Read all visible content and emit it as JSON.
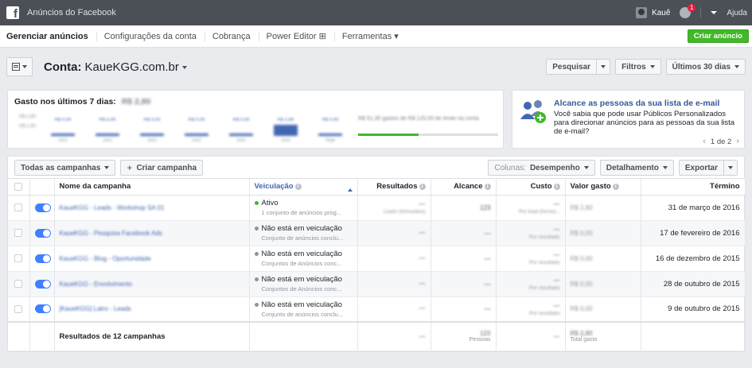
{
  "topbar": {
    "logo_glyph": "f",
    "app_title": "Anúncios do Facebook",
    "user_name": "Kauê",
    "notification_count": "1",
    "help_label": "Ajuda"
  },
  "nav": {
    "items": [
      {
        "label": "Gerenciar anúncios",
        "active": true
      },
      {
        "label": "Configurações da conta"
      },
      {
        "label": "Cobrança"
      },
      {
        "label": "Power Editor ⊞"
      },
      {
        "label": "Ferramentas ▾"
      }
    ],
    "create_ad_label": "Criar anúncio"
  },
  "account": {
    "label": "Conta:",
    "name": "KaueKGG.com.br",
    "search_label": "Pesquisar",
    "filters_label": "Filtros",
    "date_range_label": "Últimos 30 dias"
  },
  "spend": {
    "title": "Gasto nos últimos 7 dias:",
    "amount": "R$ 2,80",
    "y_labels": [
      "R$ 2,80",
      "R$ 1,40"
    ],
    "bars": [
      {
        "value": "R$ 0,00",
        "date": "20/2"
      },
      {
        "value": "R$ 0,00",
        "date": "20/2"
      },
      {
        "value": "R$ 0,00",
        "date": "20/2"
      },
      {
        "value": "R$ 0,00",
        "date": "20/2"
      },
      {
        "value": "R$ 0,00",
        "date": "20/2"
      },
      {
        "value": "R$ 2,80",
        "date": "20/2"
      },
      {
        "value": "R$ 0,00",
        "date": "Hoje"
      }
    ],
    "progress_text": "R$ 51,30 gastos de R$ 120,00 de limite na conta",
    "progress_fraction": 0.43
  },
  "tip": {
    "title": "Alcance as pessoas da sua lista de e-mail",
    "body": "Você sabia que pode usar Públicos Personalizados para direcionar anúncios para as pessoas da sua lista de e-mail?",
    "pager": "1 de 2",
    "prev_glyph": "‹",
    "next_glyph": "›"
  },
  "toolbar": {
    "all_campaigns_label": "Todas as campanhas",
    "create_campaign_label": "Criar campanha",
    "columns_prefix": "Colunas:",
    "columns_value": "Desempenho",
    "breakdown_label": "Detalhamento",
    "export_label": "Exportar"
  },
  "table": {
    "headers": {
      "name": "Nome da campanha",
      "delivery": "Veiculação",
      "results": "Resultados",
      "reach": "Alcance",
      "cost": "Custo",
      "spent": "Valor gasto",
      "end": "Término"
    },
    "rows": [
      {
        "name": "KaueKGG - Leads - Workshop SA 01",
        "status": "Ativo",
        "active": true,
        "sub": "1 conjunto de anúncios prog...",
        "results": "—",
        "results_sub": "Leads (formulário)",
        "reach": "123",
        "cost": "—",
        "cost_sub": "Por lead (formul...",
        "spent": "R$ 2,80",
        "end": "31 de março de 2016"
      },
      {
        "name": "KaueKGG - Pesquisa Facebook Ads",
        "status": "Não está em veiculação",
        "active": false,
        "sub": "Conjunto de anúncios conclu...",
        "results": "—",
        "results_sub": "",
        "reach": "—",
        "cost": "—",
        "cost_sub": "Por resultado",
        "spent": "R$ 0,00",
        "end": "17 de fevereiro de 2016"
      },
      {
        "name": "KaueKGG - Blog - Oportunidade",
        "status": "Não está em veiculação",
        "active": false,
        "sub": "Conjuntos de Anúncios conc...",
        "results": "—",
        "results_sub": "",
        "reach": "—",
        "cost": "—",
        "cost_sub": "Por resultado",
        "spent": "R$ 0,00",
        "end": "16 de dezembro de 2015"
      },
      {
        "name": "KaueKGG - Envolvimento",
        "status": "Não está em veiculação",
        "active": false,
        "sub": "Conjuntos de Anúncios conc...",
        "results": "—",
        "results_sub": "",
        "reach": "—",
        "cost": "—",
        "cost_sub": "Por resultado",
        "spent": "R$ 0,00",
        "end": "28 de outubro de 2015"
      },
      {
        "name": "[KaueKGG] Latro - Leads",
        "status": "Não está em veiculação",
        "active": false,
        "sub": "Conjunto de anúncios conclu...",
        "results": "—",
        "results_sub": "",
        "reach": "—",
        "cost": "—",
        "cost_sub": "Por resultado",
        "spent": "R$ 0,00",
        "end": "9 de outubro de 2015"
      }
    ],
    "footer": {
      "label": "Resultados de 12 campanhas",
      "results": "—",
      "reach": "123",
      "reach_sub": "Pessoas",
      "cost": "—",
      "spent": "R$ 2,80",
      "spent_sub": "Total gasto"
    }
  },
  "colors": {
    "topbar": "#4b4f56",
    "accent_blue": "#4267b2",
    "toggle_blue": "#4080ff",
    "create_green": "#42b72a"
  }
}
